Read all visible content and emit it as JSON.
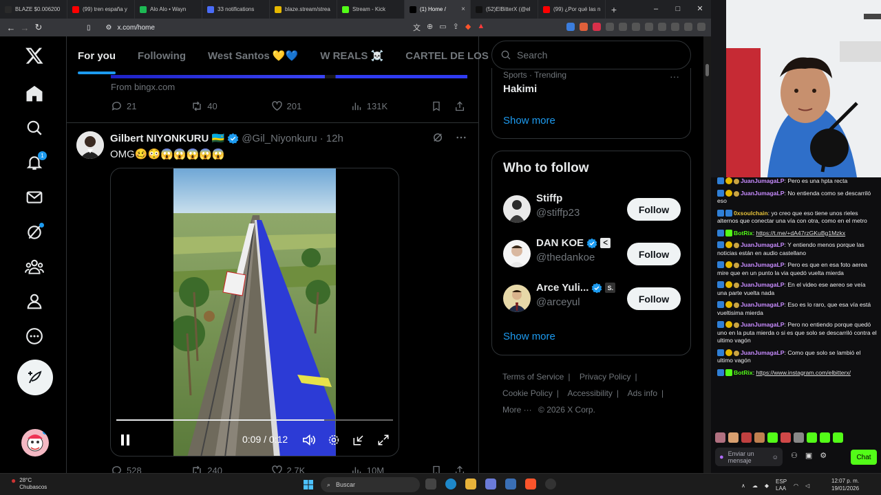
{
  "browser": {
    "tabs": [
      {
        "label": "BLAZE $0.006200",
        "color": "#2a2a2a",
        "active": false
      },
      {
        "label": "(99) tren españa y",
        "color": "#ff0000",
        "active": false
      },
      {
        "label": "Alo Alo • Wayn",
        "color": "#1db954",
        "active": false
      },
      {
        "label": "33 notifications",
        "color": "#4a6cf7",
        "active": false
      },
      {
        "label": "blaze.stream/strea",
        "color": "#e6b800",
        "active": false
      },
      {
        "label": "Stream - Kick",
        "color": "#53fc18",
        "active": false
      },
      {
        "label": "(1) Home /",
        "color": "#000000",
        "active": true
      },
      {
        "label": "(52)ElBitterX (@el",
        "color": "#111111",
        "active": false
      },
      {
        "label": "(99) ¿Por qué las n",
        "color": "#ff0000",
        "active": false
      }
    ],
    "url": "x.com/home"
  },
  "nav": {
    "notification_count": "1"
  },
  "feed_tabs": [
    "For you",
    "Following",
    "West Santos 💛💙",
    "W REALS ☠️",
    "CARTEL DE LOS"
  ],
  "promo_post": {
    "source": "From bingx.com",
    "replies": "21",
    "reposts": "40",
    "likes": "201",
    "views": "131K"
  },
  "tweet": {
    "name": "Gilbert NIYONKURU 🇷🇼",
    "handle": "@Gil_Niyonkuru",
    "time": "· 12h",
    "text": "OMG🥴😳😱😱😱😱😱",
    "video_time": "0:09 / 0:12",
    "video_progress": 0.75,
    "replies": "528",
    "reposts": "240",
    "likes": "2.7K",
    "views": "10M"
  },
  "sidebar": {
    "search_placeholder": "Search",
    "trend_meta": "Sports · Trending",
    "trend_name": "Hakimi",
    "show_more": "Show more",
    "who_to_follow_title": "Who to follow",
    "follow_label": "Follow",
    "suggestions": [
      {
        "name": "Stiffp",
        "handle": "@stiffp23",
        "verified": false,
        "badge": ""
      },
      {
        "name": "DAN KOE",
        "handle": "@thedankoe",
        "verified": true,
        "badge": "ᐸ"
      },
      {
        "name": "Arce Yuli...",
        "handle": "@arceyul",
        "verified": true,
        "badge": "S."
      }
    ],
    "footer": [
      "Terms of Service",
      "Privacy Policy",
      "Cookie Policy",
      "Accessibility",
      "Ads info",
      "More ···",
      "© 2026 X Corp."
    ]
  },
  "chat": {
    "messages": [
      {
        "user": "JuanJumagaLP",
        "color": "p",
        "text": "Pero es una hpta recta",
        "link": false
      },
      {
        "user": "JuanJumagaLP",
        "color": "p",
        "text": "No entienda como se descarriló eso",
        "link": false
      },
      {
        "user": "0xsoulchain",
        "color": "y",
        "text": "yo creo que eso tiene unos rieles alternos que conectar una vía con otra, como en el metro",
        "link": false
      },
      {
        "user": "BotRix",
        "color": "g",
        "text": "https://t.me/+dA47rzGKuBg1Mzkx",
        "link": true
      },
      {
        "user": "JuanJumagaLP",
        "color": "p",
        "text": "Y entiendo menos porque las noticias están en audio castellano",
        "link": false
      },
      {
        "user": "JuanJumagaLP",
        "color": "p",
        "text": "Pero es que en esa foto aerea mire que en un punto la via quedó vuelta mierda",
        "link": false
      },
      {
        "user": "JuanJumagaLP",
        "color": "p",
        "text": "En el video ese aereo se veía una parte vuelta nada",
        "link": false
      },
      {
        "user": "JuanJumagaLP",
        "color": "p",
        "text": "Eso es lo raro, que esa vía está vueltisima mierda",
        "link": false
      },
      {
        "user": "JuanJumagaLP",
        "color": "p",
        "text": "Pero no entiendo porque quedó uno en la puta mierda o si es que solo se descarriló contra el ultimo vagón",
        "link": false
      },
      {
        "user": "JuanJumagaLP",
        "color": "p",
        "text": "Como que solo se lambió el ultimo vagón",
        "link": false
      },
      {
        "user": "BotRix",
        "color": "g",
        "text": "https://www.instagram.com/elbitterx/",
        "link": true
      }
    ],
    "input_placeholder": "Enviar un mensaje",
    "chat_button": "Chat"
  },
  "taskbar": {
    "temp": "28°C",
    "weather": "Chubascos",
    "search": "Buscar",
    "lang": "ESP",
    "lang2": "LAA",
    "time": "12:07 p. m.",
    "date": "19/01/2026"
  }
}
